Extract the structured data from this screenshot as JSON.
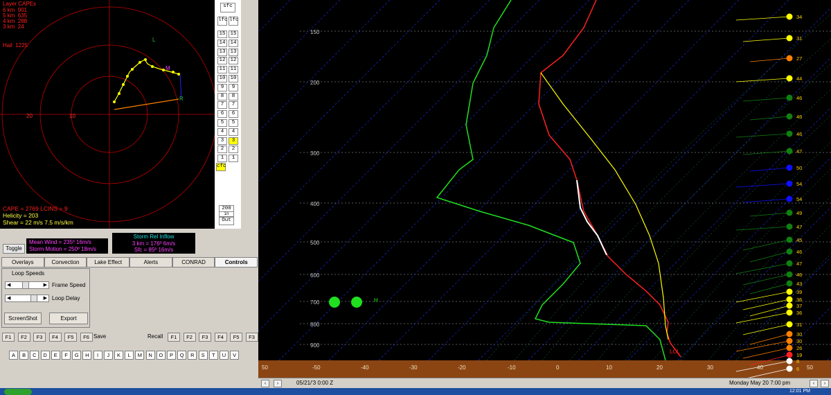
{
  "hodograph": {
    "layer_title": "Layer CAPEs",
    "layer_lines": [
      "6 km  901",
      "5 km  635",
      "4 km  288",
      "3 km  24"
    ],
    "hail": "Hail  1225",
    "axis_labels": [
      "20",
      "10"
    ],
    "point_labels": {
      "L": "L",
      "M": "M",
      "R": "R"
    },
    "cape_line": "CAPE = 2769  LCINS = 9",
    "helicity": "Helicity = 203",
    "shear": "Shear = 22 m/s  7.5 m/s/km"
  },
  "side_buttons": {
    "top": [
      "sfc",
      "lfc",
      "lfc"
    ],
    "levels": [
      "15",
      "14",
      "13",
      "12",
      "11",
      "10",
      "9",
      "8",
      "7",
      "6",
      "5",
      "4",
      "3",
      "2",
      "1"
    ],
    "selected_level": "3",
    "cfc": "cfc",
    "zoom_value": "200",
    "zoom_small": "in",
    "out": "Out"
  },
  "winds": {
    "toggle": "Toggle",
    "mean_wind": "Mean Wind = 235º  16m/s",
    "storm_motion": "Storm Motion = 250º  18m/s",
    "sr_title": "Storm Rel Inflow",
    "sr_3km": "3 km = 176º  6m/s",
    "sr_sfc": "Sfc = 85º  16m/s"
  },
  "tabs": [
    "Overlays",
    "Convection",
    "Lake Effect",
    "Alerts",
    "CONRAD",
    "Controls"
  ],
  "active_tab": "Controls",
  "controls": {
    "loop_speeds": "Loop Speeds",
    "frame_speed": "Frame Speed",
    "loop_delay": "Loop Delay",
    "screenshot": "ScreenShot",
    "export": "Export"
  },
  "fkeys_left": [
    "F1",
    "F2",
    "F3",
    "F4",
    "F5",
    "F6"
  ],
  "save_label": "Save",
  "recall_label": "Recall",
  "fkeys_right": [
    "F1",
    "F2",
    "F3",
    "F4",
    "F5",
    "F3"
  ],
  "letters": [
    "A",
    "B",
    "C",
    "D",
    "E",
    "F",
    "G",
    "H",
    "I",
    "J",
    "K",
    "L",
    "M",
    "N",
    "O",
    "P",
    "Q",
    "R",
    "S",
    "T",
    "U",
    "V"
  ],
  "skewt": {
    "pressure_labels": [
      "150",
      "200",
      "300",
      "400",
      "500",
      "600",
      "700",
      "800",
      "900"
    ],
    "temp_labels": [
      "50",
      "-50",
      "-40",
      "-30",
      "-20",
      "-10",
      "0",
      "10",
      "20",
      "30",
      "40",
      "50"
    ],
    "h_label": "H",
    "lcl_label": "LCL",
    "wind_speeds": [
      "34",
      "31",
      "27",
      "44",
      "46",
      "46",
      "46",
      "47",
      "50",
      "54",
      "54",
      "49",
      "47",
      "45",
      "46",
      "47",
      "46",
      "43",
      "39",
      "36",
      "37",
      "36",
      "31",
      "30",
      "30",
      "26",
      "19",
      "8",
      "6"
    ],
    "wind_colors": [
      "#ffff00",
      "#ffff00",
      "#ff8000",
      "#ffff00",
      "#108010",
      "#108010",
      "#108010",
      "#108010",
      "#1010ff",
      "#1010ff",
      "#1010ff",
      "#108010",
      "#108010",
      "#108010",
      "#108010",
      "#108010",
      "#108010",
      "#108010",
      "#ffff00",
      "#ffff00",
      "#ffff00",
      "#ffff00",
      "#ffff00",
      "#ff8000",
      "#ff8000",
      "#ff8000",
      "#ff2020",
      "#ffffff",
      "#ffffff"
    ]
  },
  "status": {
    "date": "05/21/'3   0:00 Z",
    "local": "Monday   May 20  7:00 pm"
  },
  "taskbar_time": "12:01 PM"
}
